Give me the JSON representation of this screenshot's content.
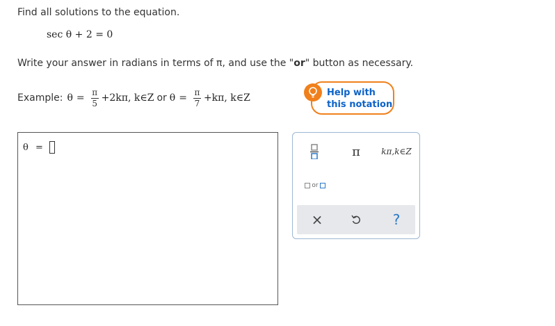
{
  "instructions": {
    "line1": "Find all solutions to the equation.",
    "line2_prefix": "Write your answer in radians in terms of π, and use the \"",
    "line2_bold": "or",
    "line2_suffix": "\" button as necessary."
  },
  "equation": {
    "func": "sec",
    "var": "θ",
    "plus": "+",
    "constant": "2",
    "equals": "=",
    "rhs": "0"
  },
  "example": {
    "label": "Example:",
    "theta": "θ",
    "equals": "=",
    "frac1_num": "π",
    "frac1_den": "5",
    "term1": "+2kπ, k∈Z",
    "or": "or",
    "frac2_num": "π",
    "frac2_den": "7",
    "term2": "+kπ, k∈Z"
  },
  "help": {
    "line1": "Help with",
    "line2": "this notation",
    "icon": "lightbulb-icon",
    "color": "#f0801c"
  },
  "answer": {
    "label": "θ",
    "equals": "="
  },
  "palette": {
    "pi": "π",
    "kpi": "kπ,k∈Z",
    "or": "or",
    "clear": "×",
    "help": "?",
    "icons": [
      "fraction-icon",
      "pi-icon",
      "kpi-set-icon",
      "or-icon",
      "clear-icon",
      "undo-icon",
      "help-icon"
    ]
  }
}
